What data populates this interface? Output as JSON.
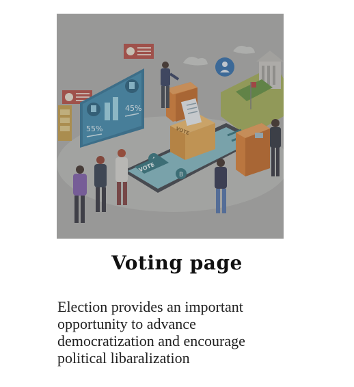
{
  "hero": {
    "board_left": "55%",
    "board_right": "45%",
    "phone_vote": "VOTE",
    "box_vote": "VOTE",
    "option_a": "A",
    "option_b": "B"
  },
  "page": {
    "title": "Voting page",
    "description": "Election provides an important opportunity to advance democratization and encourage political libaralization"
  },
  "colors": {
    "background": "#ffffff",
    "overlay": "#6b6b6b",
    "board": "#2c6f93",
    "ballot": "#e0a24c",
    "podium": "#d97a2e",
    "title": "#111111",
    "text": "#222222"
  }
}
